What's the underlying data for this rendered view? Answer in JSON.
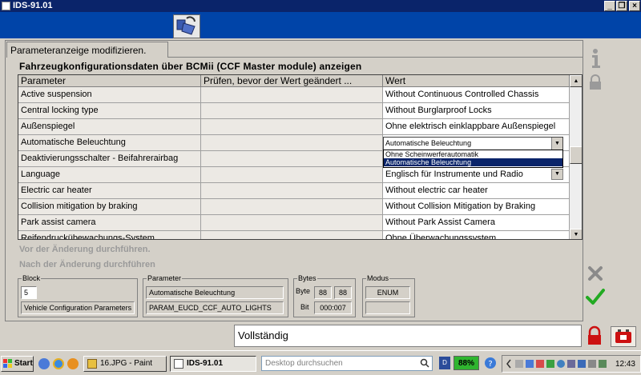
{
  "window": {
    "title": "IDS-91.01"
  },
  "panel": {
    "tab_label": "Parameteranzeige modifizieren.",
    "subtitle": "Fahrzeugkonfigurationsdaten über BCMii (CCF Master module) anzeigen"
  },
  "grid": {
    "headers": [
      "Parameter",
      "Prüfen, bevor der Wert geändert ...",
      "Wert"
    ],
    "rows": [
      {
        "param": "Active suspension",
        "check": "",
        "value": "Without Continuous Controlled Chassis"
      },
      {
        "param": "Central locking type",
        "check": "",
        "value": "Without Burglarproof Locks"
      },
      {
        "param": "Außenspiegel",
        "check": "",
        "value": "Ohne elektrisch einklappbare Außenspiegel"
      },
      {
        "param": "Automatische Beleuchtung",
        "check": "",
        "value": ""
      },
      {
        "param": "Deaktivierungsschalter - Beifahrerairbag",
        "check": "",
        "value": ""
      },
      {
        "param": "Language",
        "check": "",
        "value": "Englisch für Instrumente und Radio"
      },
      {
        "param": "Electric car heater",
        "check": "",
        "value": "Without electric car heater"
      },
      {
        "param": "Collision mitigation by braking",
        "check": "",
        "value": "Without Collision Mitigation by Braking"
      },
      {
        "param": "Park assist camera",
        "check": "",
        "value": "Without Park Assist Camera"
      },
      {
        "param": "Reifendruckübewachungs-System",
        "check": "",
        "value": "Ohne Überwachungssystem"
      }
    ],
    "combo_value": "Automatische Beleuchtung",
    "dropdown_options": [
      "Ohne Scheinwerferautomatik",
      "Automatische Beleuchtung"
    ],
    "dropdown_selected_index": 1
  },
  "hints": {
    "before": "Vor der Änderung durchführen.",
    "after": "Nach der Änderung durchführen"
  },
  "details": {
    "block_label": "Block",
    "block_number": "5",
    "block_name": "Vehicle Configuration Parameters",
    "parameter_label": "Parameter",
    "parameter_name": "Automatische Beleuchtung",
    "parameter_id": "PARAM_EUCD_CCF_AUTO_LIGHTS",
    "bytes_label": "Bytes",
    "byte_label": "Byte",
    "byte_value_1": "88",
    "byte_value_2": "88",
    "bit_label": "Bit",
    "bit_value": "000:007",
    "mode_label": "Modus",
    "mode_value": "ENUM"
  },
  "status": {
    "text": "Vollständig"
  },
  "taskbar": {
    "start": "Start",
    "paint_task": "16.JPG - Paint",
    "ids_task": "IDS-91.01",
    "search_placeholder": "Desktop durchsuchen",
    "battery": "88%",
    "clock": "12:43"
  },
  "colors": {
    "titlebar": "#0a246a",
    "toolbar_blue": "#0044a8",
    "selection": "#0a246a",
    "confirm_green": "#22aa22",
    "lock_red": "#cc1111"
  }
}
